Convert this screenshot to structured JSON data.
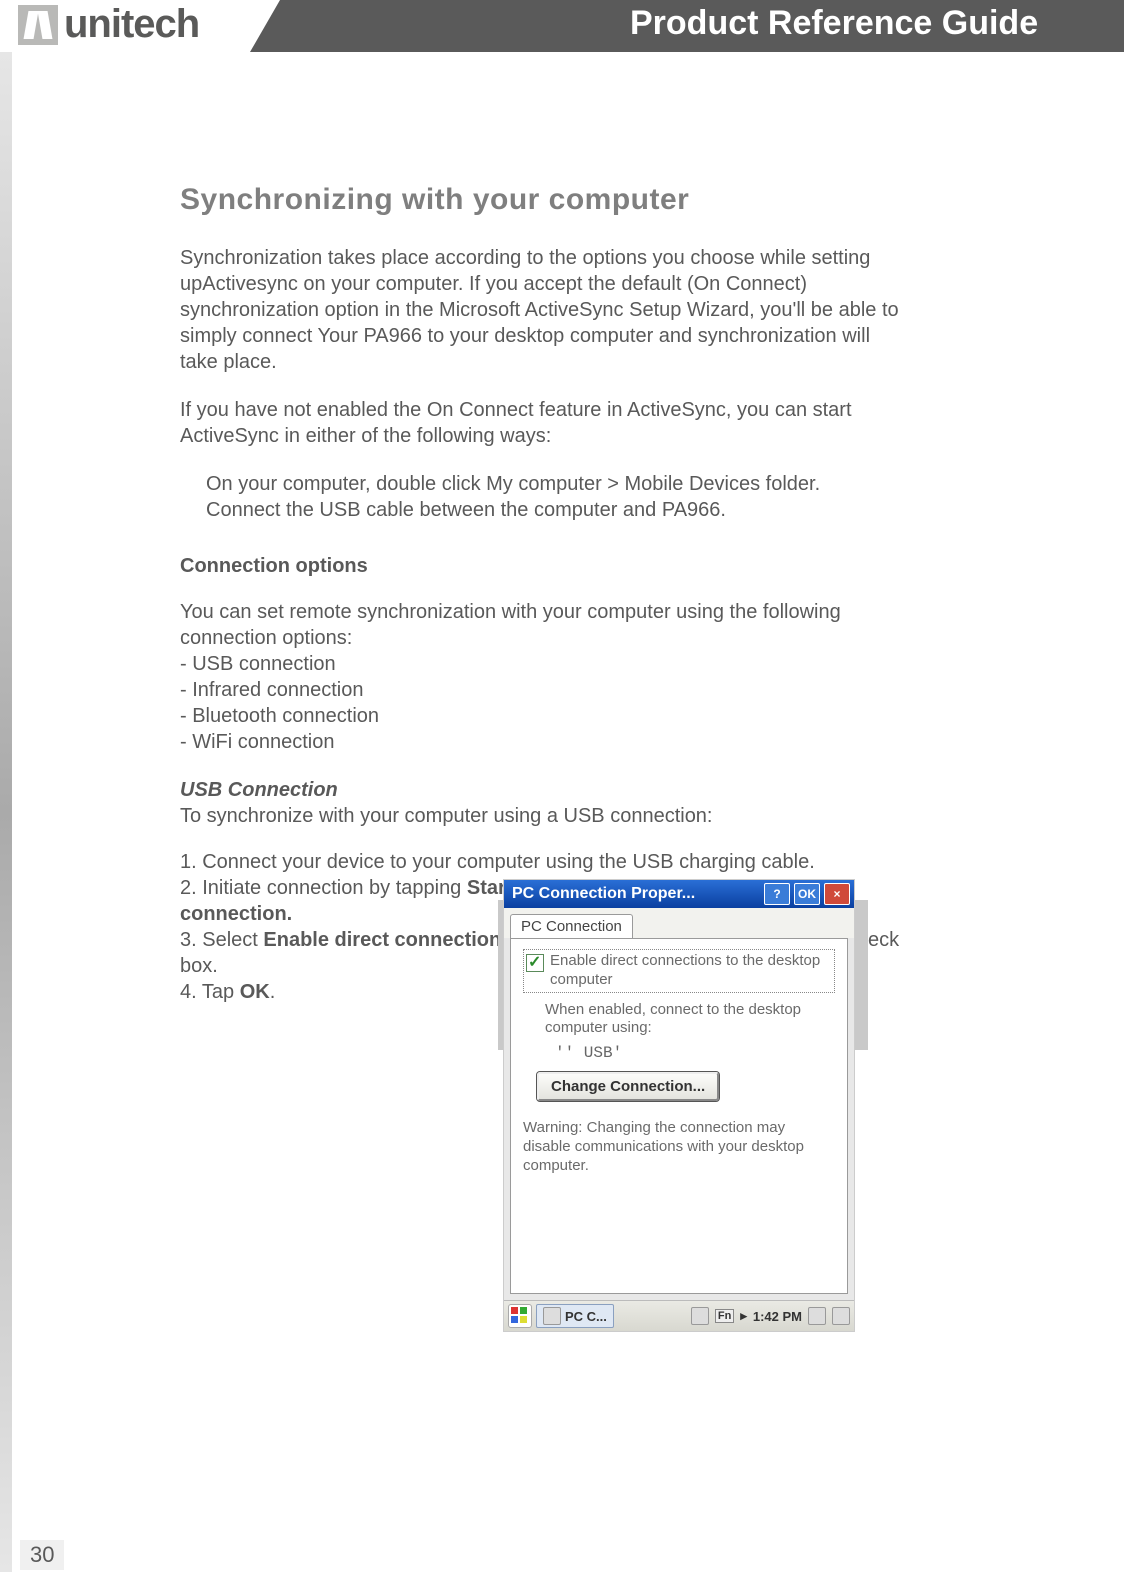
{
  "header": {
    "brand": "unitech",
    "title": "Product Reference Guide"
  },
  "page_number": "30",
  "section": {
    "title": "Synchronizing with your computer",
    "para1": "Synchronization takes place according to the options you choose while setting upActivesync on your computer. If you accept the default (On Connect) synchronization option in the Microsoft ActiveSync Setup Wizard, you'll be able to simply connect Your PA966 to your desktop computer and synchronization will take place.",
    "para2": "If you have not enabled the On Connect feature in ActiveSync, you can start ActiveSync in either of the following ways:",
    "ways": [
      "On your computer, double click My computer > Mobile Devices folder.",
      "Connect the USB cable between the computer and PA966."
    ],
    "conn_heading": "Connection options",
    "conn_intro": "You can set remote synchronization with your computer using the following connection options:",
    "conn_items": [
      "USB connection",
      "Infrared connection",
      "Bluetooth connection",
      "WiFi connection"
    ],
    "usb_heading": "USB Connection",
    "usb_intro": "To synchronize with your computer using a USB connection:",
    "steps": {
      "s1": "1. Connect your device to your computer using the USB charging cable.",
      "s2_pre": "2. Initiate connection by tapping ",
      "s2_bold": "Start > Settings > Control Panel > PC connection.",
      "s3_pre": "3. Select ",
      "s3_bold": "Enable direct connections to the desktop computer",
      "s3_post": " using this check box.",
      "s4_pre": "4. Tap ",
      "s4_bold": "OK",
      "s4_post": "."
    }
  },
  "device": {
    "title": "PC Connection Proper...",
    "help": "?",
    "ok": "OK",
    "close": "×",
    "tab": "PC Connection",
    "checkbox_label": "Enable direct connections to the desktop computer",
    "when_enabled": "When enabled, connect to the desktop computer using:",
    "usb_value": "'' USB'",
    "change_btn": "Change Connection...",
    "warning": "Warning: Changing the connection may disable communications with your desktop computer.",
    "taskbar": {
      "app": "PC C...",
      "time": "1:42 PM",
      "fn": "Fn"
    }
  }
}
